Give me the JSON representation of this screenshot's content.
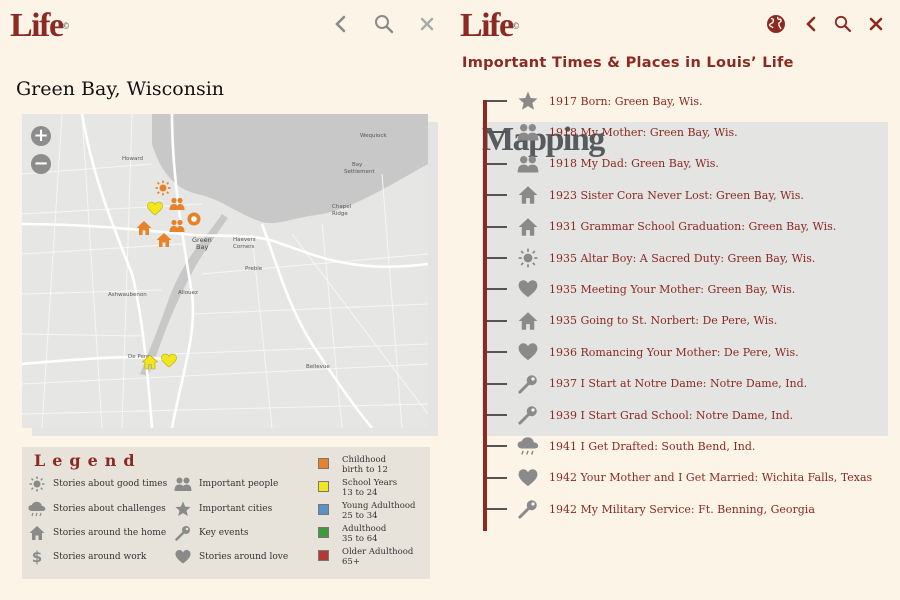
{
  "brand": {
    "life": "Life",
    "mapping": "Mapping",
    "reg": "©"
  },
  "left": {
    "place_title": "Green Bay, Wisconsin",
    "zoom_in": "+",
    "zoom_out": "−",
    "map_labels": {
      "howard": "Howard",
      "green": "Green",
      "bay": "Bay",
      "harvest1": "Haevers",
      "harvest2": "Corners",
      "preble": "Preble",
      "ashwaubenon": "Ashwaubenon",
      "allouez": "Allouez",
      "depere": "De Pere",
      "bellevue": "Bellevue",
      "wequiock": "Wequiock",
      "baysett1": "Bay",
      "baysett2": "Settlement",
      "chapel1": "Chapel",
      "chapel2": "Ridge"
    }
  },
  "legend": {
    "title": "Legend",
    "items": [
      {
        "label": "Stories about good times",
        "icon": "sun-icon"
      },
      {
        "label": "Stories about challenges",
        "icon": "cloud-rain-icon"
      },
      {
        "label": "Stories around the home",
        "icon": "house-icon"
      },
      {
        "label": "Stories around work",
        "icon": "dollar-icon"
      },
      {
        "label": "Important people",
        "icon": "people-icon"
      },
      {
        "label": "Important cities",
        "icon": "star-icon"
      },
      {
        "label": "Key events",
        "icon": "key-icon"
      },
      {
        "label": "Stories around love",
        "icon": "heart-icon"
      }
    ],
    "ages": [
      {
        "name": "Childhood",
        "range": "birth to 12",
        "color": "#e8822a"
      },
      {
        "name": "School Years",
        "range": "13 to 24",
        "color": "#f2e61c"
      },
      {
        "name": "Young Adulthood",
        "range": "25 to 34",
        "color": "#5b8fc9"
      },
      {
        "name": "Adulthood",
        "range": "35 to 64",
        "color": "#3f9a3f"
      },
      {
        "name": "Older Adulthood",
        "range": "65+",
        "color": "#b33a34"
      }
    ]
  },
  "right": {
    "heading": "Important Times & Places in Louis’ Life",
    "timeline": [
      {
        "text": "1917 Born: Green Bay, Wis.",
        "icon": "star-icon"
      },
      {
        "text": "1918 My Mother: Green Bay, Wis.",
        "icon": "people-icon"
      },
      {
        "text": "1918 My Dad: Green Bay, Wis.",
        "icon": "people-icon"
      },
      {
        "text": "1923 Sister Cora Never Lost: Green Bay, Wis.",
        "icon": "house-icon"
      },
      {
        "text": "1931 Grammar School Graduation: Green Bay, Wis.",
        "icon": "house-icon"
      },
      {
        "text": "1935 Altar Boy: A Sacred Duty: Green Bay, Wis.",
        "icon": "sun-icon"
      },
      {
        "text": "1935 Meeting Your Mother: Green Bay, Wis.",
        "icon": "heart-icon"
      },
      {
        "text": "1935 Going to St. Norbert: De Pere, Wis.",
        "icon": "house-icon"
      },
      {
        "text": "1936 Romancing Your Mother: De Pere, Wis.",
        "icon": "heart-icon"
      },
      {
        "text": "1937 I Start at Notre Dame: Notre Dame, Ind.",
        "icon": "key-icon"
      },
      {
        "text": "1939 I Start Grad School: Notre Dame, Ind.",
        "icon": "key-icon"
      },
      {
        "text": "1941 I Get Drafted: South Bend, Ind.",
        "icon": "cloud-rain-icon"
      },
      {
        "text": "1942 Your Mother and I Get Married: Wichita Falls, Texas",
        "icon": "heart-icon"
      },
      {
        "text": "1942 My Military Service: Ft. Benning, Georgia",
        "icon": "key-icon"
      }
    ]
  },
  "colors": {
    "brand_red": "#8b2a22",
    "icon_gray": "#8a8a8a",
    "marker_orange": "#e8822a",
    "marker_yellow": "#f2e61c"
  }
}
